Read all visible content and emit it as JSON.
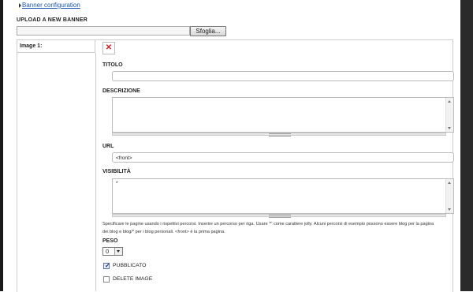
{
  "breadcrumb": {
    "link_label": "Banner configuration"
  },
  "upload": {
    "title": "UPLOAD A NEW BANNER",
    "file_value": "",
    "browse_label": "Sfoglia..."
  },
  "image": {
    "label": "Image 1:",
    "broken_icon": "broken-image-icon"
  },
  "fields": {
    "titolo": {
      "label": "TITOLO",
      "value": ""
    },
    "descrizione": {
      "label": "DESCRIZIONE",
      "value": ""
    },
    "url": {
      "label": "URL",
      "value": "<front>"
    },
    "visibilita": {
      "label": "VISIBILITÀ",
      "value": "*"
    },
    "help_line1": "Specificare le pagine usando i rispettivi percorsi. Inserire un percorso per riga. Usare '*' come carattere jolly. Alcuni percorsi di esempio possono essere blog per la pagina",
    "help_line2": "dei blog e blog/* per i blog personali. <front> è la prima pagina.",
    "peso": {
      "label": "PESO",
      "selected": "0"
    },
    "pubblicato": {
      "label": "PUBBLICATO",
      "checked": true
    },
    "delete": {
      "label": "DELETE IMAGE",
      "checked": false
    }
  },
  "colors": {
    "link": "#1a55b0",
    "border": "#cccccc",
    "error": "#d02020"
  }
}
